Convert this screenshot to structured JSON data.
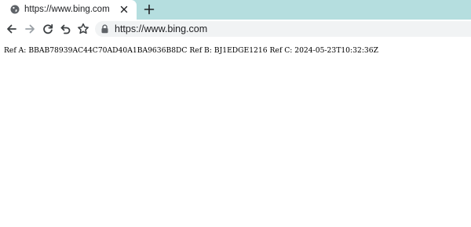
{
  "tab": {
    "title": "https://www.bing.com",
    "favicon": "globe-icon"
  },
  "toolbar": {
    "back_icon": "arrow-left-icon",
    "forward_icon": "arrow-right-icon",
    "reload_icon": "reload-icon",
    "undo_icon": "undo-icon",
    "bookmark_icon": "star-icon"
  },
  "omnibox": {
    "url": "https://www.bing.com",
    "security_icon": "lock-icon"
  },
  "page": {
    "ref_line": "Ref A: BBAB78939AC44C70AD40A1BA9636B8DC Ref B: BJ1EDGE1216 Ref C: 2024-05-23T10:32:36Z"
  },
  "colors": {
    "tabstrip_bg": "#b5dedf",
    "omnibox_bg": "#f1f3f4",
    "icon_color": "#3c4043"
  }
}
